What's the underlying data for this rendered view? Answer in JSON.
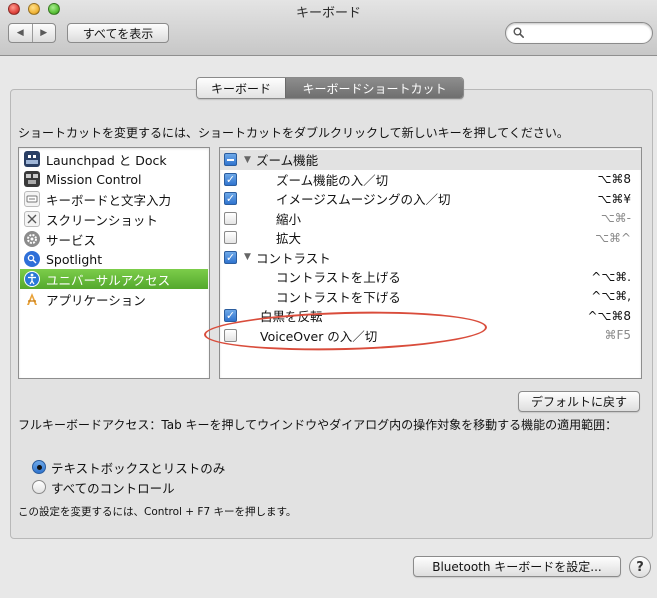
{
  "window": {
    "title": "キーボード",
    "show_all_label": "すべてを表示",
    "back_glyph": "◀",
    "forward_glyph": "▶"
  },
  "search": {
    "placeholder": ""
  },
  "tabs": [
    {
      "label": "キーボード",
      "selected": false
    },
    {
      "label": "キーボードショートカット",
      "selected": true
    }
  ],
  "instruction": "ショートカットを変更するには、ショートカットをダブルクリックして新しいキーを押してください。",
  "categories": [
    {
      "label": "Launchpad と Dock",
      "icon": "launchpad-dock-icon",
      "selected": false
    },
    {
      "label": "Mission Control",
      "icon": "mission-control-icon",
      "selected": false
    },
    {
      "label": "キーボードと文字入力",
      "icon": "keyboard-input-icon",
      "selected": false
    },
    {
      "label": "スクリーンショット",
      "icon": "screenshot-icon",
      "selected": false
    },
    {
      "label": "サービス",
      "icon": "services-gear-icon",
      "selected": false
    },
    {
      "label": "Spotlight",
      "icon": "spotlight-icon",
      "selected": false
    },
    {
      "label": "ユニバーサルアクセス",
      "icon": "universal-access-icon",
      "selected": true
    },
    {
      "label": "アプリケーション",
      "icon": "applications-icon",
      "selected": false
    }
  ],
  "shortcuts": [
    {
      "label": "ズーム機能",
      "key": "",
      "check": "mixed",
      "group": true,
      "indent": 0
    },
    {
      "label": "ズーム機能の入／切",
      "key": "⌥⌘8",
      "check": "on",
      "group": false,
      "indent": 1,
      "key_dim": false
    },
    {
      "label": "イメージスムージングの入／切",
      "key": "⌥⌘¥",
      "check": "on",
      "group": false,
      "indent": 1,
      "key_dim": false
    },
    {
      "label": "縮小",
      "key": "⌥⌘-",
      "check": "off",
      "group": false,
      "indent": 1,
      "key_dim": true
    },
    {
      "label": "拡大",
      "key": "⌥⌘^",
      "check": "off",
      "group": false,
      "indent": 1,
      "key_dim": true
    },
    {
      "label": "コントラスト",
      "key": "",
      "check": "on",
      "group": true,
      "indent": 0
    },
    {
      "label": "コントラストを上げる",
      "key": "^⌥⌘.",
      "check": "none",
      "group": false,
      "indent": 1,
      "key_dim": false
    },
    {
      "label": "コントラストを下げる",
      "key": "^⌥⌘,",
      "check": "none",
      "group": false,
      "indent": 1,
      "key_dim": false
    },
    {
      "label": "白黒を反転",
      "key": "^⌥⌘8",
      "check": "on",
      "group": false,
      "indent": 2,
      "key_dim": false
    },
    {
      "label": "VoiceOver の入／切",
      "key": "⌘F5",
      "check": "off",
      "group": false,
      "indent": 2,
      "key_dim": true
    }
  ],
  "restore_defaults_label": "デフォルトに戻す",
  "full_keyboard_access": {
    "description": "フルキーボードアクセス：Tab キーを押してウインドウやダイアログ内の操作対象を移動する機能の適用範囲：",
    "options": [
      {
        "label": "テキストボックスとリストのみ",
        "selected": true
      },
      {
        "label": "すべてのコントロール",
        "selected": false
      }
    ],
    "note": "この設定を変更するには、Control + F7 キーを押します。"
  },
  "bluetooth_label": "Bluetooth キーボードを設定...",
  "help_label": "?",
  "colors": {
    "selection_green": "#5fb532",
    "checkbox_blue": "#2f74cf",
    "annotation_red": "#d94c3b"
  }
}
